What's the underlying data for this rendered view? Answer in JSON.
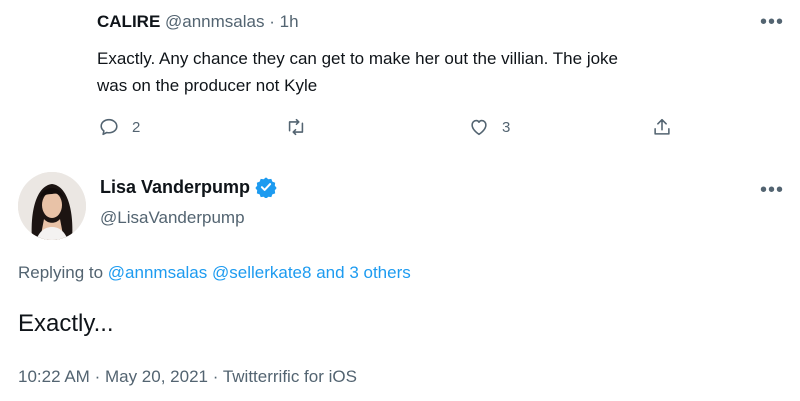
{
  "reply": {
    "name": "CALIRE",
    "handle": "@annmsalas",
    "separator": "·",
    "time": "1h",
    "text_line1": "Exactly. Any chance they can get to make her out the villian.  The joke",
    "text_line2": "was on the producer not Kyle",
    "replies": "2",
    "likes": "3"
  },
  "main": {
    "name": "Lisa Vanderpump",
    "handle": "@LisaVanderpump",
    "replying_prefix": "Replying to",
    "replying_mention1": "@annmsalas",
    "replying_mention2": "@sellerkate8",
    "replying_and": "and",
    "replying_others": "3 others",
    "text": "Exactly...",
    "meta_time": "10:22 AM",
    "meta_sep": "·",
    "meta_date": "May 20, 2021",
    "meta_sep2": "·",
    "meta_source": "Twitterrific for iOS"
  },
  "colors": {
    "accent": "#1d9bf0",
    "secondary_text": "#536471"
  },
  "icons": [
    "reply-icon",
    "retweet-icon",
    "like-icon",
    "share-icon",
    "more-icon",
    "verified-badge-icon"
  ]
}
